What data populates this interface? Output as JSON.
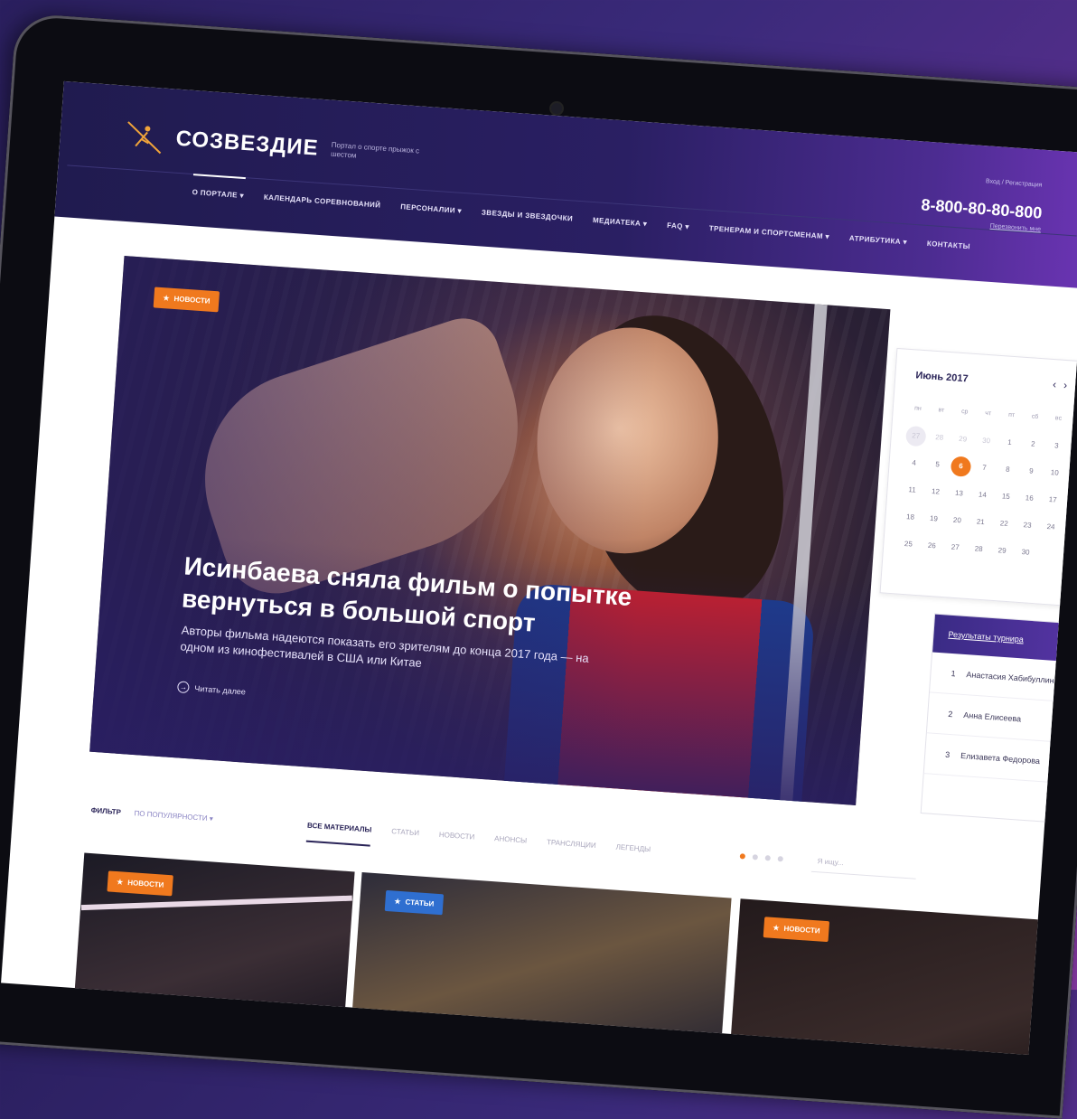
{
  "site": {
    "logo_text": "СОЗВЕЗДИЕ",
    "tagline": "Портал о спорте прыжок с шестом",
    "login": "Вход / Регистрация",
    "phone": "8-800-80-80-800",
    "callback": "Перезвонить мне"
  },
  "nav": {
    "items": [
      {
        "label": "О ПОРТАЛЕ ▾"
      },
      {
        "label": "КАЛЕНДАРЬ СОРЕВНОВАНИЙ"
      },
      {
        "label": "ПЕРСОНАЛИИ ▾"
      },
      {
        "label": "ЗВЕЗДЫ И ЗВЕЗДОЧКИ"
      },
      {
        "label": "МЕДИАТЕКА ▾"
      },
      {
        "label": "FAQ ▾"
      },
      {
        "label": "ТРЕНЕРАМ И СПОРТСМЕНАМ ▾"
      },
      {
        "label": "АТРИБУТИКА ▾"
      },
      {
        "label": "КОНТАКТЫ"
      }
    ]
  },
  "hero": {
    "badge": "НОВОСТИ",
    "title": "Исинбаева сняла фильм о попытке вернуться в большой спорт",
    "description": "Авторы фильма надеются показать его зрителям до конца 2017 года — на одном из кинофестивалей в США или Китае",
    "read_more": "Читать далее"
  },
  "calendar": {
    "month": "Июнь 2017",
    "weekdays": [
      "пн",
      "вт",
      "ср",
      "чт",
      "пт",
      "сб",
      "вс"
    ],
    "days": [
      "27",
      "28",
      "29",
      "30",
      "1",
      "2",
      "3",
      "4",
      "5",
      "6",
      "7",
      "8",
      "9",
      "10",
      "11",
      "12",
      "13",
      "14",
      "15",
      "16",
      "17",
      "18",
      "19",
      "20",
      "21",
      "22",
      "23",
      "24",
      "25",
      "26",
      "27",
      "28",
      "29",
      "30"
    ]
  },
  "results": {
    "title": "Результаты турнира",
    "rows": [
      {
        "rank": "1",
        "name": "Анастасия Хабибуллина"
      },
      {
        "rank": "2",
        "name": "Анна Елисеева"
      },
      {
        "rank": "3",
        "name": "Елизавета Федорова"
      }
    ]
  },
  "filter": {
    "label": "ФИЛЬТР",
    "value": "ПО ПОПУЛЯРНОСТИ ▾",
    "tabs": [
      {
        "label": "ВСЕ МАТЕРИАЛЫ"
      },
      {
        "label": "СТАТЬИ"
      },
      {
        "label": "НОВОСТИ"
      },
      {
        "label": "АНОНСЫ"
      },
      {
        "label": "ТРАНСЛЯЦИИ"
      },
      {
        "label": "ЛЕГЕНДЫ"
      }
    ],
    "search_placeholder": "Я ищу..."
  },
  "cards": [
    {
      "badge": "НОВОСТИ"
    },
    {
      "badge": "СТАТЬИ"
    },
    {
      "badge": "НОВОСТИ"
    }
  ],
  "colors": {
    "accent": "#f0791e",
    "brand": "#2a1f63",
    "article_badge": "#2f6fd0"
  }
}
